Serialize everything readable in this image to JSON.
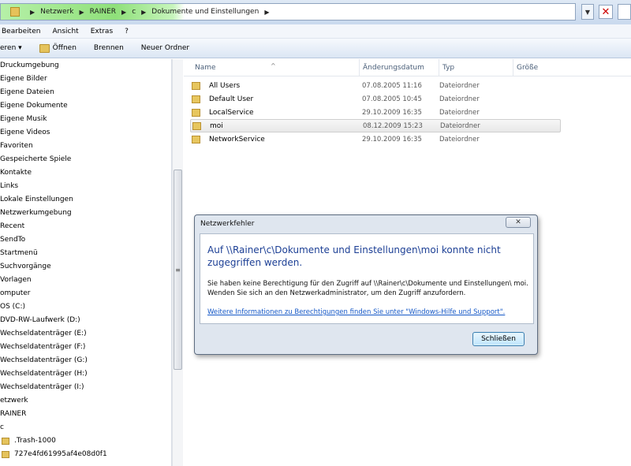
{
  "address": {
    "crumbs": [
      "Netzwerk",
      "RAINER",
      "c",
      "Dokumente und Einstellungen"
    ],
    "close_glyph": "✕"
  },
  "menu": [
    "Bearbeiten",
    "Ansicht",
    "Extras",
    "?"
  ],
  "toolbar": {
    "organize": "eren ▾",
    "open": "Öffnen",
    "burn": "Brennen",
    "new_folder": "Neuer Ordner"
  },
  "nav": {
    "items": [
      "Druckumgebung",
      "Eigene Bilder",
      "Eigene Dateien",
      "Eigene Dokumente",
      "Eigene Musik",
      "Eigene Videos",
      "Favoriten",
      "Gespeicherte Spiele",
      "Kontakte",
      "Links",
      "Lokale Einstellungen",
      "Netzwerkumgebung",
      "Recent",
      "SendTo",
      "Startmenü",
      "Suchvorgänge",
      "Vorlagen",
      "omputer",
      "OS (C:)",
      "DVD-RW-Laufwerk (D:)",
      "Wechseldatenträger (E:)",
      "Wechseldatenträger (F:)",
      "Wechseldatenträger (G:)",
      "Wechseldatenträger (H:)",
      "Wechseldatenträger (I:)",
      "etzwerk",
      "RAINER",
      "c"
    ],
    "folder_items": [
      ".Trash-1000",
      "727e4fd61995af4e08d0f1"
    ]
  },
  "columns": [
    "Name",
    "Änderungsdatum",
    "Typ",
    "Größe"
  ],
  "files": [
    {
      "name": "All Users",
      "date": "07.08.2005 11:16",
      "type": "Dateiordner"
    },
    {
      "name": "Default User",
      "date": "07.08.2005 10:45",
      "type": "Dateiordner"
    },
    {
      "name": "LocalService",
      "date": "29.10.2009 16:35",
      "type": "Dateiordner"
    },
    {
      "name": "moi",
      "date": "08.12.2009 15:23",
      "type": "Dateiordner"
    },
    {
      "name": "NetworkService",
      "date": "29.10.2009 16:35",
      "type": "Dateiordner"
    }
  ],
  "dialog": {
    "title": "Netzwerkfehler",
    "close": "✕",
    "main": "Auf \\\\Rainer\\c\\Dokumente und Einstellungen\\moi konnte nicht zugegriffen werden.",
    "sub": "Sie haben keine Berechtigung für den Zugriff auf \\\\Rainer\\c\\Dokumente und Einstellungen\\ moi. Wenden Sie sich an den Netzwerkadministrator, um den Zugriff anzufordern.",
    "link": "Weitere Informationen zu Berechtigungen finden Sie unter \"Windows-Hilfe und Support\".",
    "button": "Schließen"
  }
}
